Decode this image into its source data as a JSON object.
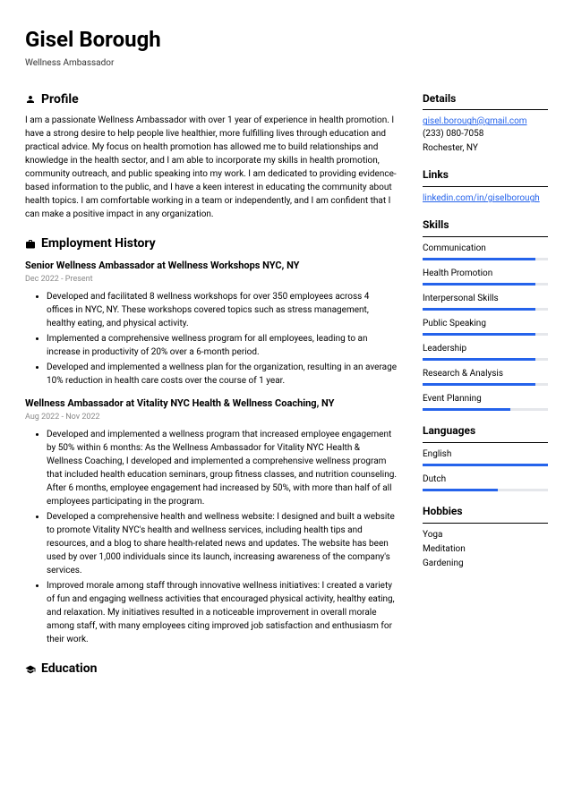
{
  "header": {
    "name": "Gisel Borough",
    "title": "Wellness Ambassador"
  },
  "profile": {
    "heading": "Profile",
    "text": "I am a passionate Wellness Ambassador with over 1 year of experience in health promotion. I have a strong desire to help people live healthier, more fulfilling lives through education and practical advice. My focus on health promotion has allowed me to build relationships and knowledge in the health sector, and I am able to incorporate my skills in health promotion, community outreach, and public speaking into my work. I am dedicated to providing evidence-based information to the public, and I have a keen interest in educating the community about health topics. I am comfortable working in a team or independently, and I am confident that I can make a positive impact in any organization."
  },
  "employment": {
    "heading": "Employment History",
    "jobs": [
      {
        "title": "Senior Wellness Ambassador at Wellness Workshops NYC, NY",
        "dates": "Dec 2022 - Present",
        "bullets": [
          "Developed and facilitated 8 wellness workshops for over 350 employees across 4 offices in NYC, NY. These workshops covered topics such as stress management, healthy eating, and physical activity.",
          "Implemented a comprehensive wellness program for all employees, leading to an increase in productivity of 20% over a 6-month period.",
          "Developed and implemented a wellness plan for the organization, resulting in an average 10% reduction in health care costs over the course of 1 year."
        ]
      },
      {
        "title": "Wellness Ambassador at Vitality NYC Health & Wellness Coaching, NY",
        "dates": "Aug 2022 - Nov 2022",
        "bullets": [
          "Developed and implemented a wellness program that increased employee engagement by 50% within 6 months: As the Wellness Ambassador for Vitality NYC Health & Wellness Coaching, I developed and implemented a comprehensive wellness program that included health education seminars, group fitness classes, and nutrition counseling. After 6 months, employee engagement had increased by 50%, with more than half of all employees participating in the program.",
          "Developed a comprehensive health and wellness website: I designed and built a website to promote Vitality NYC's health and wellness services, including health tips and resources, and a blog to share health-related news and updates. The website has been used by over 1,000 individuals since its launch, increasing awareness of the company's services.",
          "Improved morale among staff through innovative wellness initiatives: I created a variety of fun and engaging wellness activities that encouraged physical activity, healthy eating, and relaxation. My initiatives resulted in a noticeable improvement in overall morale among staff, with many employees citing improved job satisfaction and enthusiasm for their work."
        ]
      }
    ]
  },
  "education": {
    "heading": "Education"
  },
  "details": {
    "heading": "Details",
    "email": "gisel.borough@gmail.com",
    "phone": "(233) 080-7058",
    "location": "Rochester, NY"
  },
  "links": {
    "heading": "Links",
    "items": [
      "linkedin.com/in/giselborough"
    ]
  },
  "skills": {
    "heading": "Skills",
    "items": [
      {
        "label": "Communication",
        "pct": 90
      },
      {
        "label": "Health Promotion",
        "pct": 90
      },
      {
        "label": "Interpersonal Skills",
        "pct": 90
      },
      {
        "label": "Public Speaking",
        "pct": 90
      },
      {
        "label": "Leadership",
        "pct": 90
      },
      {
        "label": "Research & Analysis",
        "pct": 90
      },
      {
        "label": "Event Planning",
        "pct": 70
      }
    ]
  },
  "languages": {
    "heading": "Languages",
    "items": [
      {
        "label": "English",
        "pct": 100
      },
      {
        "label": "Dutch",
        "pct": 60
      }
    ]
  },
  "hobbies": {
    "heading": "Hobbies",
    "items": [
      "Yoga",
      "Meditation",
      "Gardening"
    ]
  }
}
